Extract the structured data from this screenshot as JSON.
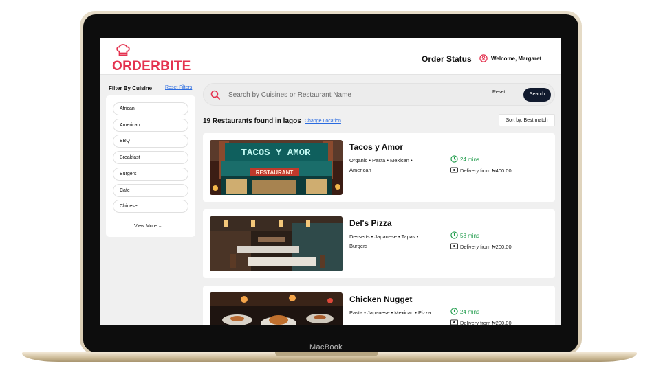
{
  "device": {
    "brand": "MacBook"
  },
  "header": {
    "logo_text": "ORDERBITE",
    "order_status": "Order Status",
    "welcome": "Welcome, Margaret"
  },
  "sidebar": {
    "title": "Filter By Cuisine",
    "reset_label": "Reset Filters",
    "cuisines": [
      "African",
      "American",
      "BBQ",
      "Breakfast",
      "Burgers",
      "Cafe",
      "Chinese"
    ],
    "view_more": "View More"
  },
  "search": {
    "placeholder": "Search by Cuisines or Restaurant Name",
    "reset_label": "Reset",
    "search_label": "Search"
  },
  "results": {
    "count_text": "19 Restaurants found in lagos",
    "change_location": "Change Location",
    "sort_label": "Sort by: Best match"
  },
  "restaurants": [
    {
      "name": "Tacos y Amor",
      "tags_line1": "Organic  •  Pasta  •  Mexican  •",
      "tags_line2": "American",
      "time": "24 mins",
      "delivery": "Delivery from ₦400.00",
      "sign_text": "TACOS Y AMOR",
      "sign_sub": "RESTAURANT"
    },
    {
      "name": "Del's Pizza",
      "tags_line1": "Desserts  •  Japanese  •  Tapas  •",
      "tags_line2": "Burgers",
      "time": "58 mins",
      "delivery": "Delivery from ₦200.00"
    },
    {
      "name": "Chicken Nugget",
      "tags_line1": "Pasta  •  Japanese  •  Mexican  •  Pizza",
      "tags_line2": "",
      "time": "24 mins",
      "delivery": "Delivery from ₦200.00"
    }
  ],
  "colors": {
    "brand": "#e4324f",
    "link": "#2a6be0",
    "time_green": "#1c9a48",
    "button_dark": "#111a2e"
  }
}
